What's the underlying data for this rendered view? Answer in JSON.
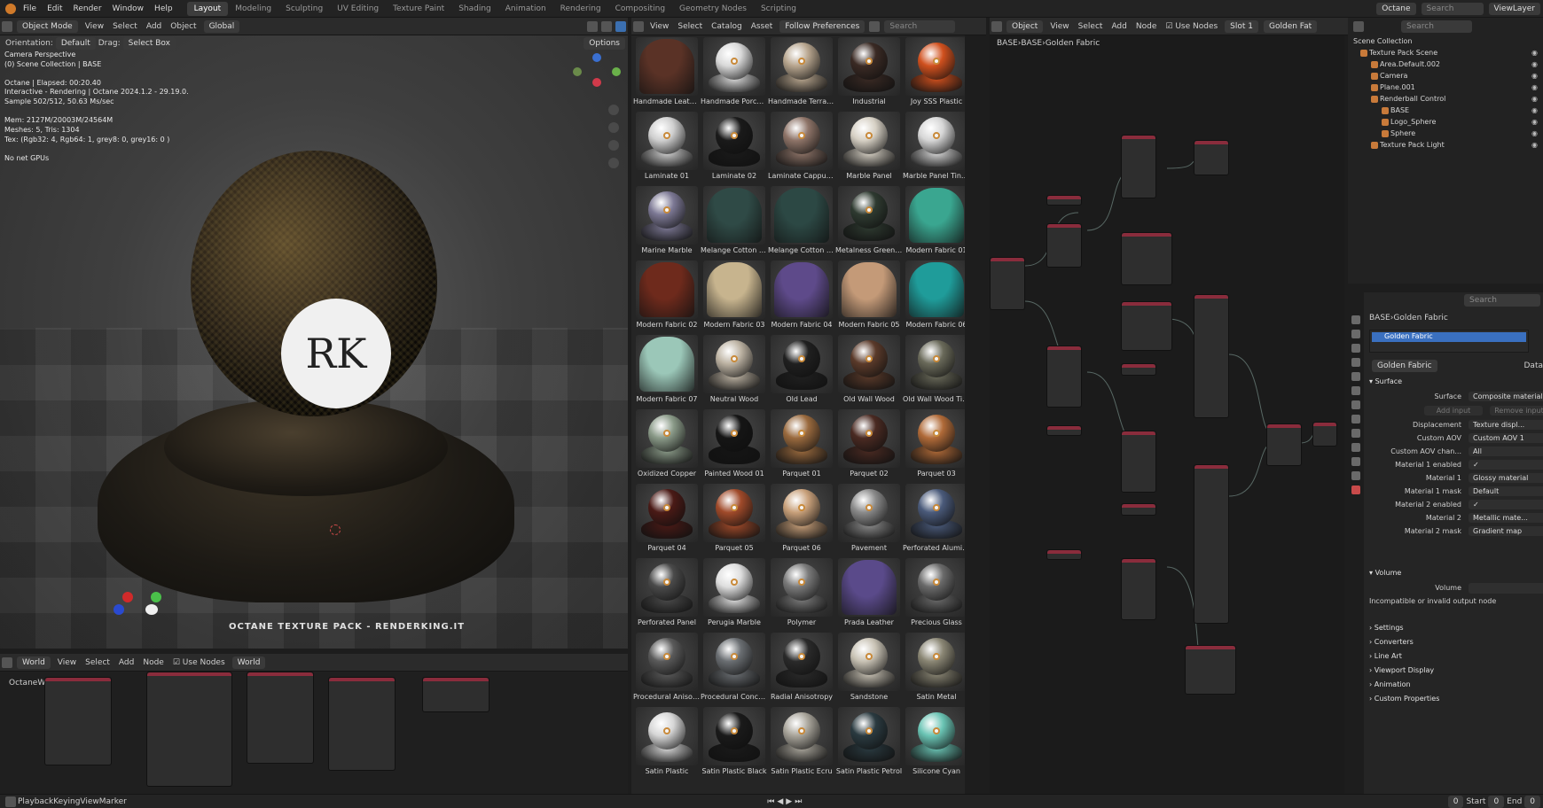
{
  "topbar": {
    "menus": [
      "File",
      "Edit",
      "Render",
      "Window",
      "Help"
    ],
    "workspaces": [
      "Layout",
      "Modeling",
      "Sculpting",
      "UV Editing",
      "Texture Paint",
      "Shading",
      "Animation",
      "Rendering",
      "Compositing",
      "Geometry Nodes",
      "Scripting"
    ],
    "active_workspace": "Layout",
    "engine": "Octane",
    "view_layer": "ViewLayer",
    "search_placeholder": "Search"
  },
  "viewport": {
    "mode": "Object Mode",
    "menu": [
      "View",
      "Select",
      "Add",
      "Object"
    ],
    "orientation_label": "Orientation:",
    "orientation": "Default",
    "drag_label": "Drag:",
    "drag": "Select Box",
    "transform": "Global",
    "options": "Options",
    "overlay_lines": [
      "Camera Perspective",
      "(0) Scene Collection | BASE",
      "Octane | Elapsed: 00:20.40",
      "Interactive - Rendering | Octane 2024.1.2 - 29.19.0.",
      "Sample 502/512, 50.63 Ms/sec",
      "Mem: 2127M/20003M/24564M",
      "Meshes: 5, Tris: 1304",
      "Tex: (Rgb32: 4, Rgb64: 1, grey8: 0, grey16: 0 )",
      "No net GPUs"
    ],
    "logo_text": "RK",
    "watermark": "OCTANE TEXTURE PACK - RENDERKING.IT"
  },
  "browser": {
    "menu": [
      "View",
      "Select",
      "Catalog",
      "Asset"
    ],
    "filter": "Follow Preferences",
    "search_placeholder": "Search",
    "assets": [
      {
        "name": "Handmade Leather",
        "kind": "drape",
        "color": "#5a3226"
      },
      {
        "name": "Handmade Porcelain",
        "kind": "ball",
        "color": "#d9d9d9"
      },
      {
        "name": "Handmade Terrac...",
        "kind": "ball",
        "color": "#b7a58e"
      },
      {
        "name": "Industrial",
        "kind": "ball",
        "color": "#3a2a24"
      },
      {
        "name": "Joy SSS Plastic",
        "kind": "ball",
        "color": "#d0501e"
      },
      {
        "name": "Laminate 01",
        "kind": "ball",
        "color": "#cfcfcf"
      },
      {
        "name": "Laminate 02",
        "kind": "ball",
        "color": "#1a1a1a"
      },
      {
        "name": "Laminate Cappucc...",
        "kind": "ball",
        "color": "#8e7468"
      },
      {
        "name": "Marble Panel",
        "kind": "ball",
        "color": "#d6d0c4"
      },
      {
        "name": "Marble Panel Tinted",
        "kind": "ball",
        "color": "#d6d6d6"
      },
      {
        "name": "Marine Marble",
        "kind": "ball",
        "color": "#7c7894"
      },
      {
        "name": "Melange Cotton C...",
        "kind": "drape",
        "color": "#2f4a46"
      },
      {
        "name": "Melange Cotton Gr...",
        "kind": "drape",
        "color": "#2c4844"
      },
      {
        "name": "Metalness Green ...",
        "kind": "ball",
        "color": "#2e3a30"
      },
      {
        "name": "Modern Fabric 01",
        "kind": "drape",
        "color": "#3aa690"
      },
      {
        "name": "Modern Fabric 02",
        "kind": "drape",
        "color": "#6e2a1c"
      },
      {
        "name": "Modern Fabric 03",
        "kind": "drape",
        "color": "#c7b48e"
      },
      {
        "name": "Modern Fabric 04",
        "kind": "drape",
        "color": "#5e4a8a"
      },
      {
        "name": "Modern Fabric 05",
        "kind": "drape",
        "color": "#c49a78"
      },
      {
        "name": "Modern Fabric 06",
        "kind": "drape",
        "color": "#1f9c9a"
      },
      {
        "name": "Modern Fabric 07",
        "kind": "drape",
        "color": "#9bc7b8"
      },
      {
        "name": "Neutral Wood",
        "kind": "ball",
        "color": "#bdb3a3"
      },
      {
        "name": "Old Lead",
        "kind": "ball",
        "color": "#202020"
      },
      {
        "name": "Old Wall Wood",
        "kind": "ball",
        "color": "#5a3a2a"
      },
      {
        "name": "Old Wall Wood Tin...",
        "kind": "ball",
        "color": "#6a6a5a"
      },
      {
        "name": "Oxidized Copper",
        "kind": "ball",
        "color": "#8a9a88"
      },
      {
        "name": "Painted Wood 01",
        "kind": "ball",
        "color": "#151515"
      },
      {
        "name": "Parquet 01",
        "kind": "ball",
        "color": "#9a6a3e"
      },
      {
        "name": "Parquet 02",
        "kind": "ball",
        "color": "#4a2a22"
      },
      {
        "name": "Parquet 03",
        "kind": "ball",
        "color": "#b06a38"
      },
      {
        "name": "Parquet 04",
        "kind": "ball",
        "color": "#4a1a16"
      },
      {
        "name": "Parquet 05",
        "kind": "ball",
        "color": "#a04a2a"
      },
      {
        "name": "Parquet 06",
        "kind": "ball",
        "color": "#c8a07a"
      },
      {
        "name": "Pavement",
        "kind": "ball",
        "color": "#8a8a8a"
      },
      {
        "name": "Perforated Alumin...",
        "kind": "ball",
        "color": "#4a5a7a"
      },
      {
        "name": "Perforated Panel",
        "kind": "ball",
        "color": "#4a4a4a"
      },
      {
        "name": "Perugia Marble",
        "kind": "ball",
        "color": "#dedede"
      },
      {
        "name": "Polymer",
        "kind": "ball",
        "color": "#7a7a7a"
      },
      {
        "name": "Prada Leather",
        "kind": "drape",
        "color": "#5a4a8a"
      },
      {
        "name": "Precious Glass",
        "kind": "ball",
        "color": "#6a6a6a"
      },
      {
        "name": "Procedural Anisotr...",
        "kind": "ball",
        "color": "#5a5a5a"
      },
      {
        "name": "Procedural Concrete",
        "kind": "ball",
        "color": "#6a6e72"
      },
      {
        "name": "Radial Anisotropy",
        "kind": "ball",
        "color": "#2a2a2a"
      },
      {
        "name": "Sandstone",
        "kind": "ball",
        "color": "#c8c2b4"
      },
      {
        "name": "Satin Metal",
        "kind": "ball",
        "color": "#8a8674"
      },
      {
        "name": "Satin Plastic",
        "kind": "ball",
        "color": "#d6d6d6"
      },
      {
        "name": "Satin Plastic Black",
        "kind": "ball",
        "color": "#1a1a1a"
      },
      {
        "name": "Satin Plastic Ecru",
        "kind": "ball",
        "color": "#a8a49a"
      },
      {
        "name": "Satin Plastic Petrol",
        "kind": "ball",
        "color": "#2a3a40"
      },
      {
        "name": "Silicone Cyan",
        "kind": "ball",
        "color": "#6ac4b4"
      }
    ]
  },
  "node_editor": {
    "type": "Object",
    "menu": [
      "View",
      "Select",
      "Add",
      "Node"
    ],
    "use_nodes": "Use Nodes",
    "slot": "Slot 1",
    "material": "Golden Fat",
    "breadcrumb": [
      "BASE",
      "BASE",
      "Golden Fabric"
    ]
  },
  "outliner": {
    "title": "Scene Collection",
    "items": [
      {
        "label": "Texture Pack Scene",
        "indent": 1
      },
      {
        "label": "Area.Default.002",
        "indent": 2
      },
      {
        "label": "Camera",
        "indent": 2
      },
      {
        "label": "Plane.001",
        "indent": 2
      },
      {
        "label": "Renderball Control",
        "indent": 2
      },
      {
        "label": "BASE",
        "indent": 3
      },
      {
        "label": "Logo_Sphere",
        "indent": 3
      },
      {
        "label": "Sphere",
        "indent": 3
      },
      {
        "label": "Texture Pack Light",
        "indent": 2
      }
    ]
  },
  "properties": {
    "search_placeholder": "Search",
    "breadcrumb": [
      "BASE",
      "Golden Fabric"
    ],
    "slot_item": "Golden Fabric",
    "material_name": "Golden Fabric",
    "data_tab": "Data",
    "surface_section": "Surface",
    "add_input": "Add input",
    "remove_input": "Remove input",
    "fields": [
      {
        "label": "Surface",
        "value": "Composite material"
      },
      {
        "label": "Displacement",
        "value": "Texture displ..."
      },
      {
        "label": "Custom AOV",
        "value": "Custom AOV 1"
      },
      {
        "label": "Custom AOV chan...",
        "value": "All"
      },
      {
        "label": "Material 1 enabled",
        "value": "✓"
      },
      {
        "label": "Material 1",
        "value": "Glossy material"
      },
      {
        "label": "Material 1 mask",
        "value": "Default"
      },
      {
        "label": "Material 2 enabled",
        "value": "✓"
      },
      {
        "label": "Material 2",
        "value": "Metallic mate..."
      },
      {
        "label": "Material 2 mask",
        "value": "Gradient map"
      }
    ],
    "volume_section": "Volume",
    "volume_label": "Volume",
    "volume_note": "Incompatible or invalid output node",
    "collapsed": [
      "Settings",
      "Converters",
      "Line Art",
      "Viewport Display",
      "Animation",
      "Custom Properties"
    ]
  },
  "bottom_node": {
    "world": "World",
    "menu": [
      "View",
      "Select",
      "Add",
      "Node"
    ],
    "use_nodes": "Use Nodes",
    "world2": "World",
    "octane": "Octane",
    "world_node": "World"
  },
  "timeline": {
    "menu": [
      "Playback",
      "Keying",
      "View",
      "Marker"
    ],
    "frame": "0",
    "start_label": "Start",
    "start": "0",
    "end_label": "End",
    "end": "0"
  }
}
